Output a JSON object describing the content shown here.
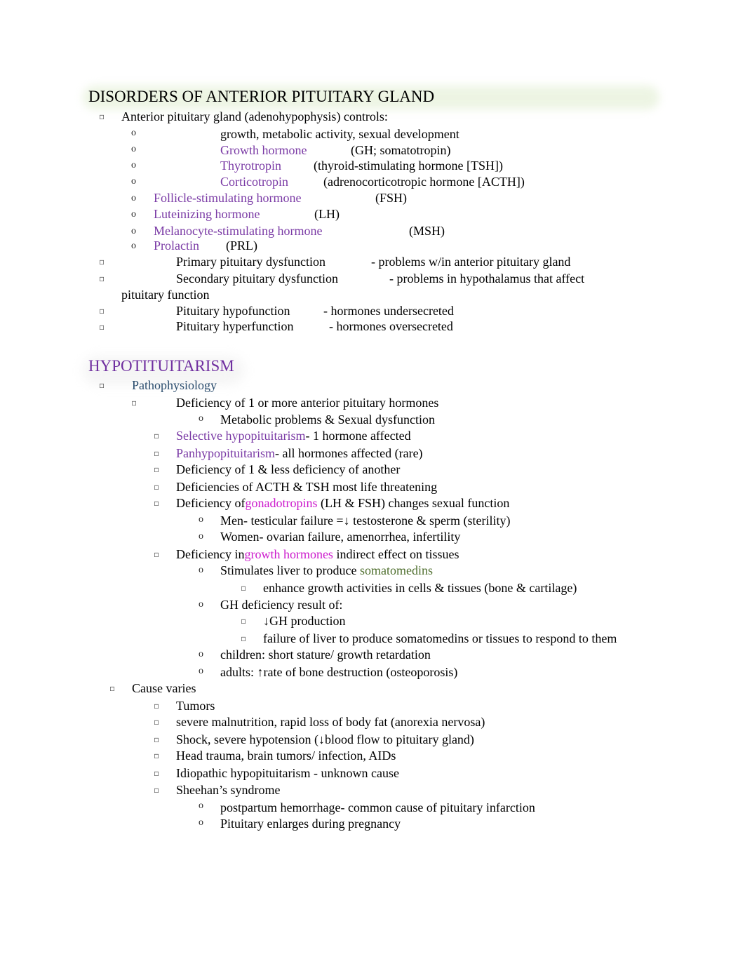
{
  "colors": {
    "term_purple": "#7a3aa5",
    "heading_purple": "#7030a0",
    "magenta": "#cc19cc",
    "navy": "#2b4d6e",
    "olive": "#4f6f2e",
    "heading_highlight": "#eaf3df"
  },
  "icons": {
    "square_bullet": "square-bullet-icon",
    "circle_bullet": "o"
  },
  "section1": {
    "title": "DISORDERS OF ANTERIOR PITUITARY GLAND",
    "intro": "Anterior pituitary gland  (adenohypophysis) controls:",
    "controls": [
      {
        "term": "",
        "desc": "growth, metabolic activity, sexual development"
      },
      {
        "term": "Growth hormone",
        "desc": "(GH; somatotropin)"
      },
      {
        "term": "Thyrotropin",
        "desc": "(thyroid-stimulating hormone [TSH])"
      },
      {
        "term": "Corticotropin",
        "desc": "(adrenocorticotropic hormone [ACTH])"
      },
      {
        "term": "Follicle-stimulating hormone",
        "desc": "(FSH)"
      },
      {
        "term": "Luteinizing hormone",
        "desc": "(LH)"
      },
      {
        "term": "Melanocyte-stimulating hormone",
        "desc": "(MSH)"
      },
      {
        "term": "Prolactin",
        "desc": "(PRL)"
      }
    ],
    "dysfunctions": [
      {
        "term": "Primary pituitary dysfunction",
        "desc": "- problems w/in anterior pituitary gland"
      },
      {
        "term": "Secondary pituitary dysfunction",
        "desc": "- problems in hypothalamus that affect",
        "continuation": "pituitary function"
      },
      {
        "term": "Pituitary hypofunction",
        "desc": "- hormones undersecreted"
      },
      {
        "term": "Pituitary hyperfunction",
        "desc": "- hormones oversecreted"
      }
    ]
  },
  "section2": {
    "title": "HYPOTITUITARISM",
    "pathophysiology": {
      "label": "Pathophysiology",
      "deficiency": "Deficiency of 1 or more anterior pituitary hormones",
      "deficiency_sub": "Metabolic problems & Sexual dysfunction",
      "selective_term": "Selective hypopituitarism",
      "selective_desc": "- 1 hormone affected",
      "pan_term": "Panhypopituitarism",
      "pan_desc": "- all hormones affected (rare)",
      "item_less": "Deficiency of 1 & less deficiency of another",
      "item_acth": "Deficiencies of ACTH & TSH most life threatening",
      "gonad_pre": "Deficiency of",
      "gonad_term": "gonadotropins",
      "gonad_post": " (LH & FSH) changes sexual function",
      "men": "Men- testicular failure =↓ testosterone & sperm (sterility)",
      "women": "Women- ovarian failure, amenorrhea, infertility",
      "gh_pre": "Deficiency in",
      "gh_term": "growth hormones",
      "gh_post": " indirect effect on tissues",
      "liver_pre": "Stimulates liver to produce ",
      "liver_term": "somatomedins",
      "enhance": "enhance growth activities in cells & tissues (bone & cartilage)",
      "gh_def": "GH deficiency result of:",
      "gh_prod": "↓GH production",
      "liver_fail": "failure of liver to produce somatomedins or tissues to respond to them",
      "children": "children: short stature/ growth retardation",
      "adults": "adults: ↑rate of bone destruction (osteoporosis)"
    },
    "causes": {
      "label": "Cause varies",
      "items": [
        "Tumors",
        "severe malnutrition, rapid loss of body fat (anorexia nervosa)",
        "Shock, severe hypotension (↓blood flow to pituitary gland)",
        "Head trauma, brain tumors/ infection, AIDs",
        "Idiopathic hypopituitarism - unknown cause",
        "Sheehan’s syndrome"
      ],
      "sheehan_sub": [
        "postpartum hemorrhage- common cause of pituitary infarction",
        "Pituitary enlarges during pregnancy"
      ]
    }
  }
}
